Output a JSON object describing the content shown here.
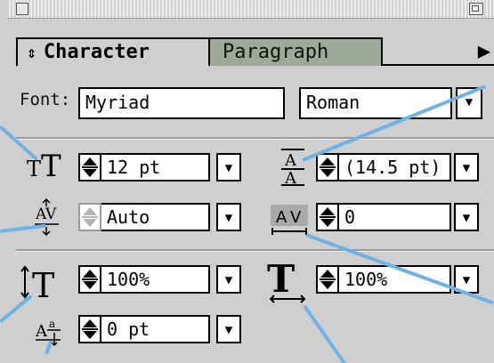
{
  "tabs": [
    {
      "label": "Character",
      "glyph": "⇕"
    },
    {
      "label": "Paragraph"
    }
  ],
  "menu_arrow": "▶",
  "font": {
    "label": "Font:",
    "family": "Myriad",
    "style": "Roman",
    "dropdown_glyph": "▼"
  },
  "controls": {
    "size": {
      "value": "12 pt",
      "icon": "font-size-icon"
    },
    "leading": {
      "value": "(14.5 pt)",
      "icon": "leading-icon"
    },
    "kerning": {
      "value": "Auto",
      "icon": "kerning-icon"
    },
    "tracking": {
      "value": "0",
      "icon": "tracking-icon"
    },
    "vertical_scale": {
      "value": "100%",
      "icon": "vertical-scale-icon"
    },
    "horizontal_scale": {
      "value": "100%",
      "icon": "horizontal-scale-icon"
    },
    "baseline_shift": {
      "value": "0 pt",
      "icon": "baseline-shift-icon"
    }
  },
  "colors": {
    "panel_bg": "#cfcfcf",
    "inactive_tab": "#9ea99a",
    "callout": "#6fb2e3"
  }
}
